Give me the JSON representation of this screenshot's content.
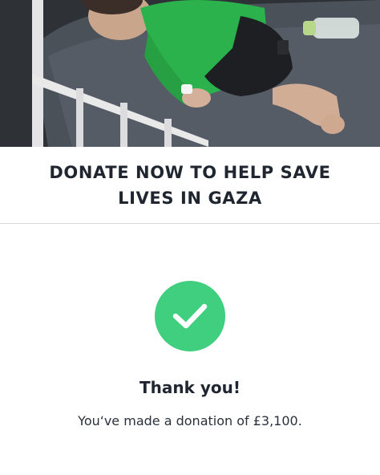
{
  "hero": {
    "image_description": "hero-photo",
    "colors": {
      "bed_blanket": "#4a5058",
      "shirt": "#2bb24c",
      "rail": "#e9e9ea"
    }
  },
  "header": {
    "title": "DONATE NOW TO HELP SAVE LIVES IN GAZA"
  },
  "confirmation": {
    "icon": "checkmark-icon",
    "accent_color": "#3fcf7f",
    "heading": "Thank you!",
    "message": "You‘ve made a donation of £3,100."
  }
}
